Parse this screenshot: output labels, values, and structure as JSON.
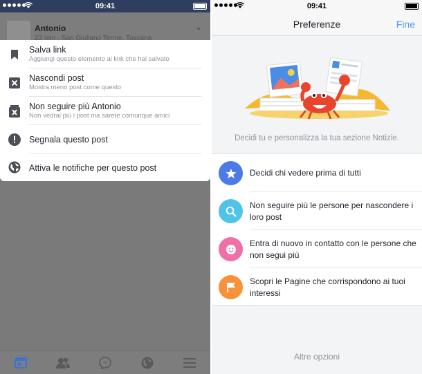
{
  "left": {
    "status": {
      "time": "09:41"
    },
    "post": {
      "author": "Antonio",
      "meta": "22 min · San Giuliano Terme, Toscana"
    },
    "menu": [
      {
        "icon": "bookmark-icon",
        "title": "Salva link",
        "subtitle": "Aggiungi questo elemento ai link che hai salvato"
      },
      {
        "icon": "close-box-icon",
        "title": "Nascondi post",
        "subtitle": "Mostra meno post come questo"
      },
      {
        "icon": "unfollow-icon",
        "title": "Non seguire più Antonio",
        "subtitle": "Non vedrai più i post ma sarete comunque amici"
      },
      {
        "icon": "alert-icon",
        "title": "Segnala questo post",
        "subtitle": ""
      },
      {
        "icon": "globe-icon",
        "title": "Attiva le notifiche per questo post",
        "subtitle": ""
      }
    ],
    "tabs": [
      "news-feed-icon",
      "friends-icon",
      "messenger-icon",
      "globe-notifications-icon",
      "menu-icon"
    ]
  },
  "right": {
    "status": {
      "time": "09:41"
    },
    "nav": {
      "title": "Preferenze",
      "done": "Fine"
    },
    "intro": "Decidi tu e personalizza la tua sezione Notizie.",
    "options": [
      {
        "icon": "star-icon",
        "color": "#4c7be8",
        "text": "Decidi chi vedere prima di tutti"
      },
      {
        "icon": "search-icon",
        "color": "#4fc3e8",
        "text": "Non seguire più le persone per nascondere i loro post"
      },
      {
        "icon": "smile-icon",
        "color": "#ef6fa6",
        "text": "Entra di nuovo in contatto con le persone che non segui più"
      },
      {
        "icon": "flag-icon",
        "color": "#f7923a",
        "text": "Scopri le Pagine che corrispondono ai tuoi interessi"
      }
    ],
    "more": "Altre opzioni"
  }
}
